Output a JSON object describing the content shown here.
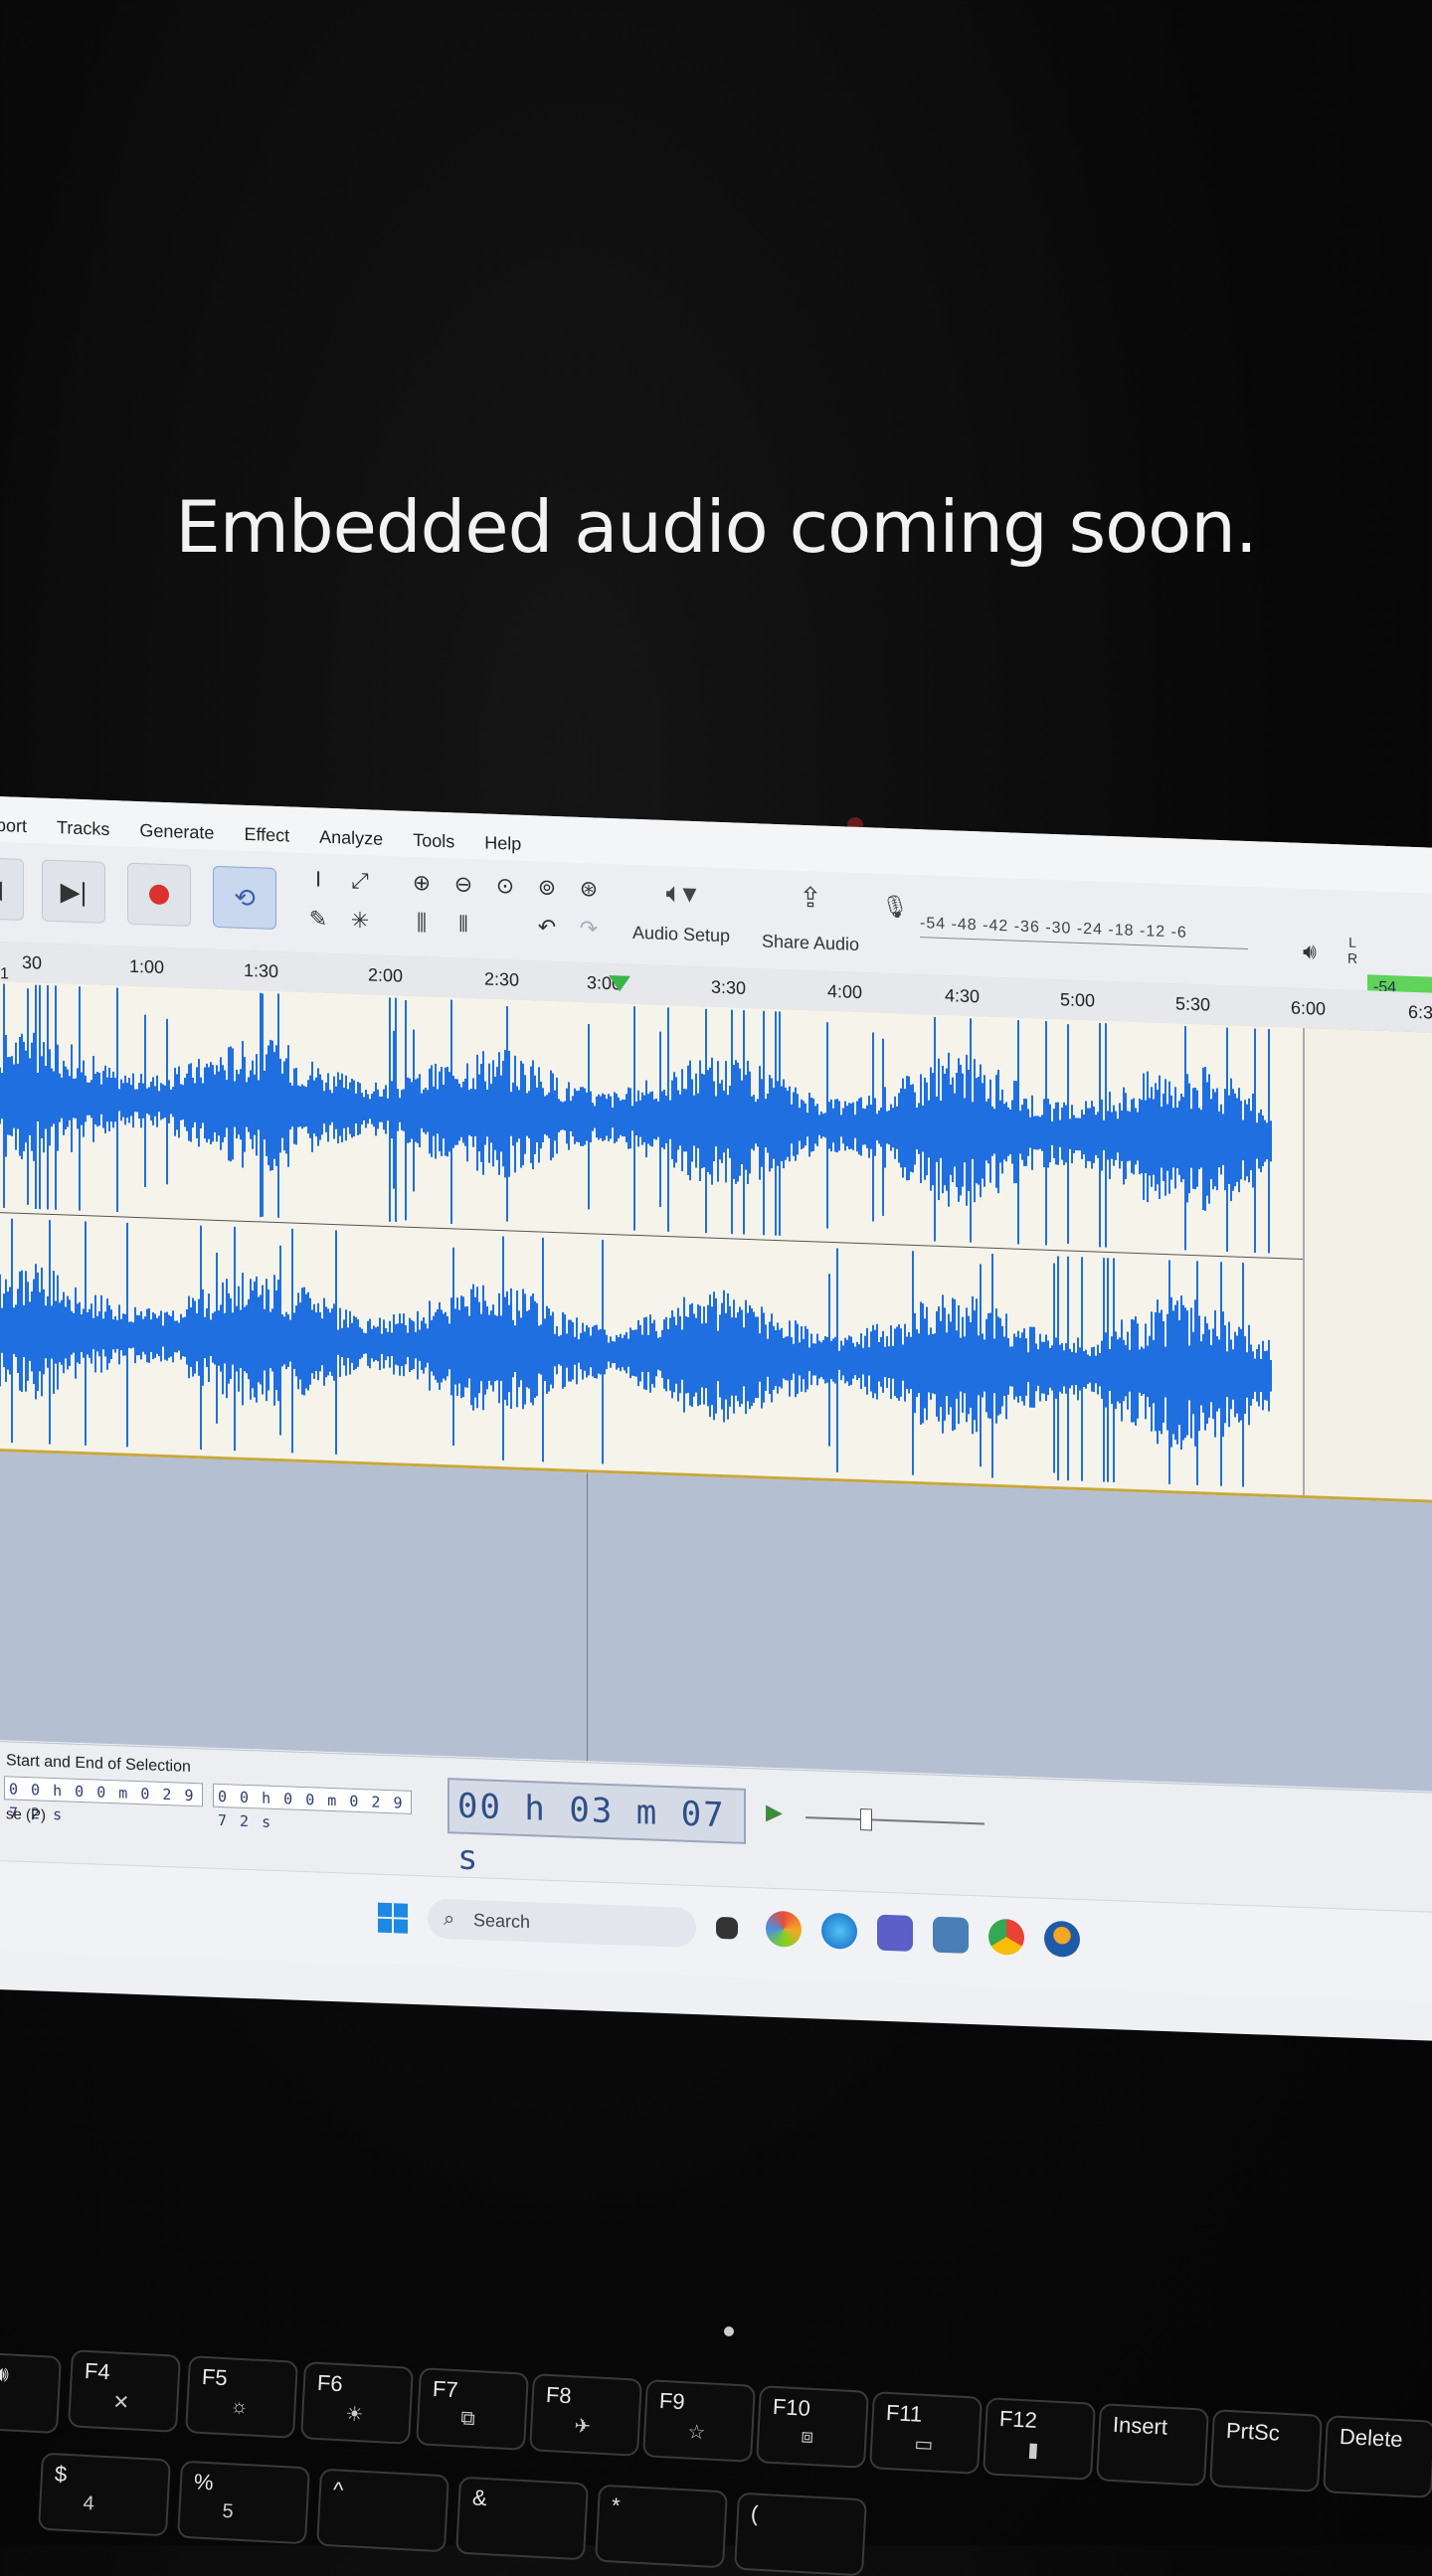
{
  "caption": "Embedded audio coming soon.",
  "menu": [
    "port",
    "Tracks",
    "Generate",
    "Effect",
    "Analyze",
    "Tools",
    "Help"
  ],
  "toolbar": {
    "audio_setup_label": "Audio Setup",
    "share_audio_label": "Share Audio",
    "meter_scale": "-54 -48 -42 -36 -30 -24 -18 -12 -6",
    "meter_lr": "L R",
    "playback_meter_value": "-54"
  },
  "ruler": {
    "start_marker": "1",
    "ticks": [
      "30",
      "1:00",
      "1:30",
      "2:00",
      "2:30",
      "3:00",
      "3:30",
      "4:00",
      "4:30",
      "5:00",
      "5:30",
      "6:00",
      "6:3"
    ]
  },
  "selection": {
    "label": "Start and End of Selection",
    "start": "0 0 h 0 0 m 0 2 9 7 2 s",
    "end": "0 0 h 0 0 m 0 2 9 7 2 s",
    "mode": "se (P)"
  },
  "time_display": "00 h 03 m 07 s",
  "taskbar": {
    "search_label": "Search"
  },
  "keyboard": {
    "fkeys": [
      "F4",
      "F5",
      "F6",
      "F7",
      "F8",
      "F9",
      "F10",
      "F11",
      "F12",
      "Insert",
      "PrtSc",
      "Delete"
    ],
    "num_row": [
      "$",
      "%",
      "^",
      "&",
      "*",
      "("
    ],
    "num_sub": [
      "4",
      "5",
      "",
      "",
      "",
      ""
    ]
  },
  "colors": {
    "waveform": "#1f6fe0",
    "record": "#d9332b",
    "track_bg": "#f6f3ea",
    "empty_area": "#b5bfd2"
  }
}
